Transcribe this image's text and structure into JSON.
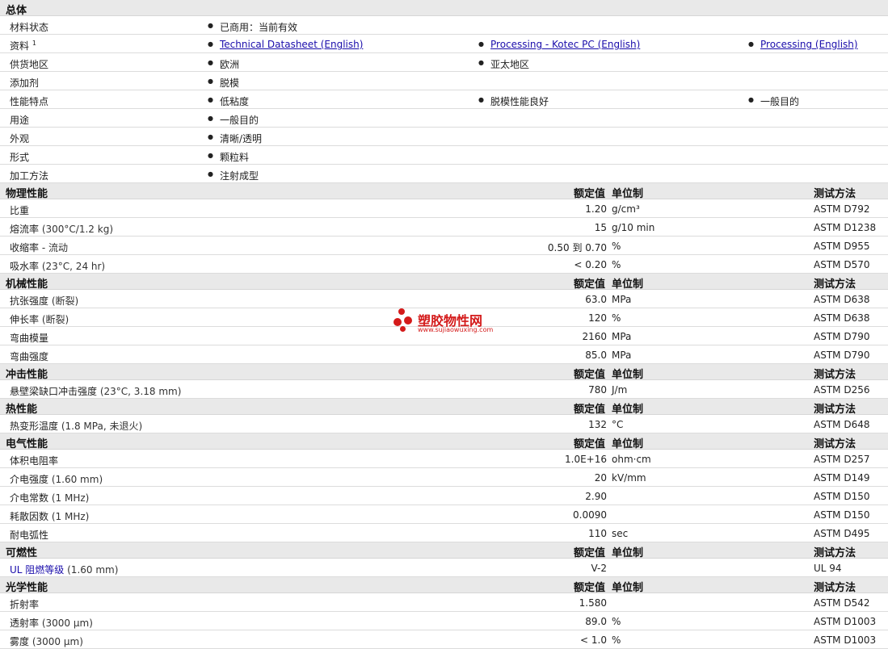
{
  "sections": [
    {
      "title": "总体",
      "type": "general",
      "rows": [
        {
          "label": "材料状态",
          "items": [
            {
              "text": "已商用：当前有效"
            }
          ]
        },
        {
          "label": "资料",
          "sup": "1",
          "items": [
            {
              "text": "Technical Datasheet (English)",
              "link": true
            },
            {
              "text": "Processing - Kotec PC (English)",
              "link": true
            },
            {
              "text": "Processing (English)",
              "link": true
            }
          ]
        },
        {
          "label": "供货地区",
          "items": [
            {
              "text": "欧洲"
            },
            {
              "text": "亚太地区"
            }
          ]
        },
        {
          "label": "添加剂",
          "items": [
            {
              "text": "脱模"
            }
          ]
        },
        {
          "label": "性能特点",
          "items": [
            {
              "text": "低粘度"
            },
            {
              "text": "脱模性能良好"
            },
            {
              "text": "一般目的"
            }
          ]
        },
        {
          "label": "用途",
          "items": [
            {
              "text": "一般目的"
            }
          ]
        },
        {
          "label": "外观",
          "items": [
            {
              "text": "清晰/透明"
            }
          ]
        },
        {
          "label": "形式",
          "items": [
            {
              "text": "颗粒料"
            }
          ]
        },
        {
          "label": "加工方法",
          "items": [
            {
              "text": "注射成型"
            }
          ]
        }
      ]
    },
    {
      "title": "物理性能",
      "type": "props",
      "headers": {
        "value": "额定值",
        "unit": "单位制",
        "method": "测试方法"
      },
      "rows": [
        {
          "label": "比重",
          "cond": "",
          "value": "1.20",
          "unit": "g/cm³",
          "method": "ASTM D792"
        },
        {
          "label": "熔流率",
          "cond": "(300°C/1.2 kg)",
          "value": "15",
          "unit": "g/10 min",
          "method": "ASTM D1238"
        },
        {
          "label": "收缩率",
          "cond": "- 流动",
          "value": "0.50 到  0.70",
          "unit": "%",
          "method": "ASTM D955"
        },
        {
          "label": "吸水率",
          "cond": "(23°C, 24 hr)",
          "value": "< 0.20",
          "unit": "%",
          "method": "ASTM D570"
        }
      ]
    },
    {
      "title": "机械性能",
      "type": "props",
      "headers": {
        "value": "额定值",
        "unit": "单位制",
        "method": "测试方法"
      },
      "rows": [
        {
          "label": "抗张强度",
          "cond": "(断裂)",
          "value": "63.0",
          "unit": "MPa",
          "method": "ASTM D638"
        },
        {
          "label": "伸长率",
          "cond": "(断裂)",
          "value": "120",
          "unit": "%",
          "method": "ASTM D638"
        },
        {
          "label": "弯曲模量",
          "cond": "",
          "value": "2160",
          "unit": "MPa",
          "method": "ASTM D790"
        },
        {
          "label": "弯曲强度",
          "cond": "",
          "value": "85.0",
          "unit": "MPa",
          "method": "ASTM D790"
        }
      ]
    },
    {
      "title": "冲击性能",
      "type": "props",
      "headers": {
        "value": "额定值",
        "unit": "单位制",
        "method": "测试方法"
      },
      "rows": [
        {
          "label": "悬壁梁缺口冲击强度",
          "cond": "(23°C, 3.18 mm)",
          "value": "780",
          "unit": "J/m",
          "method": "ASTM D256"
        }
      ]
    },
    {
      "title": "热性能",
      "type": "props",
      "headers": {
        "value": "额定值",
        "unit": "单位制",
        "method": "测试方法"
      },
      "rows": [
        {
          "label": "热变形温度",
          "cond": "(1.8 MPa, 未退火)",
          "value": "132",
          "unit": "°C",
          "method": "ASTM D648"
        }
      ]
    },
    {
      "title": "电气性能",
      "type": "props",
      "headers": {
        "value": "额定值",
        "unit": "单位制",
        "method": "测试方法"
      },
      "rows": [
        {
          "label": "体积电阻率",
          "cond": "",
          "value": "1.0E+16",
          "unit": "ohm·cm",
          "method": "ASTM D257"
        },
        {
          "label": "介电强度",
          "cond": "(1.60 mm)",
          "value": "20",
          "unit": "kV/mm",
          "method": "ASTM D149"
        },
        {
          "label": "介电常数",
          "cond": "(1 MHz)",
          "value": "2.90",
          "unit": "",
          "method": "ASTM D150"
        },
        {
          "label": "耗散因数",
          "cond": "(1 MHz)",
          "value": "0.0090",
          "unit": "",
          "method": "ASTM D150"
        },
        {
          "label": "耐电弧性",
          "cond": "",
          "value": "110",
          "unit": "sec",
          "method": "ASTM D495"
        }
      ]
    },
    {
      "title": "可燃性",
      "type": "props",
      "headers": {
        "value": "额定值",
        "unit": "单位制",
        "method": "测试方法"
      },
      "rows": [
        {
          "label": "UL 阻燃等级",
          "cond": "(1.60 mm)",
          "value": "V-2",
          "unit": "",
          "method": "UL 94",
          "ul": true
        }
      ]
    },
    {
      "title": "光学性能",
      "type": "props",
      "headers": {
        "value": "额定值",
        "unit": "单位制",
        "method": "测试方法"
      },
      "rows": [
        {
          "label": "折射率",
          "cond": "",
          "value": "1.580",
          "unit": "",
          "method": "ASTM D542"
        },
        {
          "label": "透射率",
          "cond": "(3000 µm)",
          "value": "89.0",
          "unit": "%",
          "method": "ASTM D1003"
        },
        {
          "label": "雾度",
          "cond": "(3000 µm)",
          "value": "< 1.0",
          "unit": "%",
          "method": "ASTM D1003"
        }
      ]
    }
  ],
  "watermark": {
    "text": "塑胶物性网",
    "url": "www.sujiaowuxing.com",
    "color": "#d41a1a"
  }
}
